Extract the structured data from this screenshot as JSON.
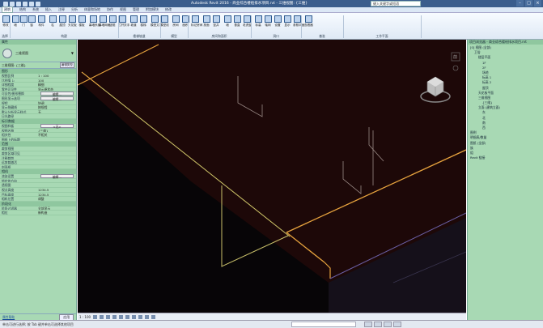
{
  "titlebar": {
    "title": "Autodesk Revit 2016 - 商业综合楼给排水项目.rvt - 三维视图: {三维}",
    "search_placeholder": "键入关键字或短语"
  },
  "ribbon_tabs": [
    "建筑",
    "结构",
    "系统",
    "插入",
    "注释",
    "分析",
    "体量和场地",
    "协作",
    "视图",
    "管理",
    "附加模块",
    "修改"
  ],
  "ribbon": {
    "buttons": [
      "修改",
      "墙",
      "门",
      "窗",
      "构件",
      "柱",
      "屋顶",
      "天花板",
      "楼板",
      "幕墙系统",
      "幕墙网格",
      "竖梃",
      "栏杆扶手",
      "坡道",
      "楼梯",
      "模型文字",
      "模型线",
      "房间",
      "面积",
      "标记房间",
      "按面",
      "竖井",
      "墙",
      "垂直",
      "老虎窗",
      "标高",
      "轴网",
      "设置",
      "显示",
      "参照平面",
      "查看器"
    ],
    "groups": [
      "选择",
      "构建",
      "楼梯坡道",
      "模型",
      "房间和面积",
      "洞口",
      "基准",
      "工作平面"
    ]
  },
  "properties": {
    "header": "属性",
    "type_name": "三维视图",
    "type_selector": "三维视图: {三维}",
    "edit_type": "编辑类型",
    "sections": [
      {
        "title": "图形",
        "rows": [
          {
            "k": "视图比例",
            "v": "1 : 100"
          },
          {
            "k": "比例值 1:",
            "v": "100"
          },
          {
            "k": "详细程度",
            "v": "精细"
          },
          {
            "k": "零件可见性",
            "v": "显示原状态"
          },
          {
            "k": "可见性/图形替换",
            "v": "编辑...",
            "btn": true
          },
          {
            "k": "图形显示选项",
            "v": "编辑...",
            "btn": true
          },
          {
            "k": "规程",
            "v": "协调"
          },
          {
            "k": "显示隐藏线",
            "v": "按规程"
          },
          {
            "k": "默认分析显示样式",
            "v": "无"
          },
          {
            "k": "日光路径",
            "v": ""
          }
        ]
      },
      {
        "title": "标识数据",
        "rows": [
          {
            "k": "视图样板",
            "v": "<无>",
            "btn": true
          },
          {
            "k": "视图名称",
            "v": "{三维}"
          },
          {
            "k": "相关性",
            "v": "不相关"
          },
          {
            "k": "图纸上的标题",
            "v": ""
          }
        ]
      },
      {
        "title": "范围",
        "rows": [
          {
            "k": "裁剪视图",
            "v": ""
          },
          {
            "k": "裁剪区域可见",
            "v": ""
          },
          {
            "k": "注释裁剪",
            "v": ""
          },
          {
            "k": "远剪裁激活",
            "v": ""
          },
          {
            "k": "剖面框",
            "v": ""
          }
        ]
      },
      {
        "title": "相机",
        "rows": [
          {
            "k": "渲染设置",
            "v": "编辑...",
            "btn": true
          },
          {
            "k": "锁定的方向",
            "v": ""
          },
          {
            "k": "透视图",
            "v": ""
          },
          {
            "k": "视点高度",
            "v": "1234.5"
          },
          {
            "k": "目标高度",
            "v": "1234.5"
          },
          {
            "k": "相机位置",
            "v": "调整"
          }
        ]
      },
      {
        "title": "阶段化",
        "rows": [
          {
            "k": "阶段过滤器",
            "v": "全部显示"
          },
          {
            "k": "相位",
            "v": "新构造"
          }
        ]
      }
    ],
    "help_link": "属性帮助",
    "apply_label": "应用"
  },
  "viewport": {
    "navbar_label": "前",
    "scale": "1 : 100"
  },
  "browser": {
    "header": "项目浏览器 - 商业综合楼给排水项目.rvt",
    "items": [
      {
        "t": "[0] 视图 (全部)",
        "d": 0
      },
      {
        "t": "卫浴",
        "d": 1
      },
      {
        "t": "楼层平面",
        "d": 2
      },
      {
        "t": "1F",
        "d": 3
      },
      {
        "t": "2F",
        "d": 3
      },
      {
        "t": "场地",
        "d": 3
      },
      {
        "t": "标高 1",
        "d": 3
      },
      {
        "t": "标高 2",
        "d": 3
      },
      {
        "t": "屋顶",
        "d": 3
      },
      {
        "t": "天花板平面",
        "d": 2
      },
      {
        "t": "三维视图",
        "d": 2
      },
      {
        "t": "{三维}",
        "d": 3
      },
      {
        "t": "立面 (建筑立面)",
        "d": 2
      },
      {
        "t": "东",
        "d": 3
      },
      {
        "t": "北",
        "d": 3
      },
      {
        "t": "南",
        "d": 3
      },
      {
        "t": "西",
        "d": 3
      },
      {
        "t": "图例",
        "d": 0
      },
      {
        "t": "明细表/数量",
        "d": 0
      },
      {
        "t": "图纸 (全部)",
        "d": 0
      },
      {
        "t": "族",
        "d": 0
      },
      {
        "t": "组",
        "d": 0
      },
      {
        "t": "Revit 链接",
        "d": 0
      }
    ]
  },
  "statusbar": {
    "text": "单击可进行选择; 按 Tab 键并单击可选择其他项目"
  }
}
